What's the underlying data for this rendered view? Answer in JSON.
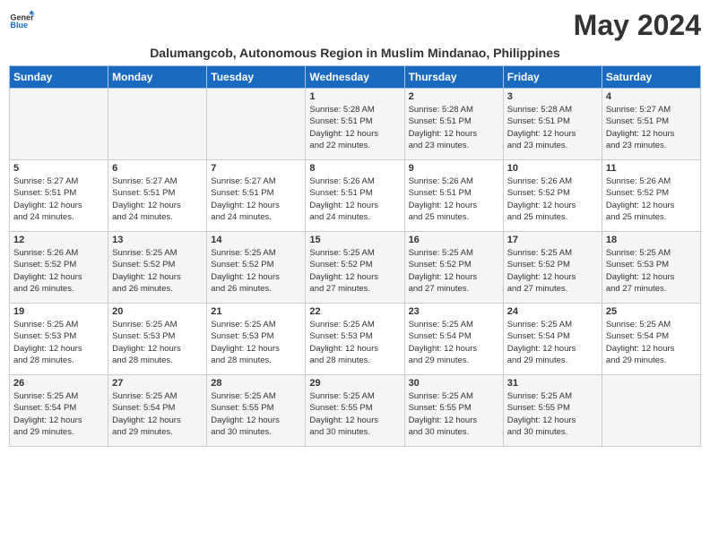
{
  "logo": {
    "line1": "General",
    "line2": "Blue"
  },
  "month_title": "May 2024",
  "location": "Dalumangcob, Autonomous Region in Muslim Mindanao, Philippines",
  "days_of_week": [
    "Sunday",
    "Monday",
    "Tuesday",
    "Wednesday",
    "Thursday",
    "Friday",
    "Saturday"
  ],
  "weeks": [
    [
      {
        "day": "",
        "info": ""
      },
      {
        "day": "",
        "info": ""
      },
      {
        "day": "",
        "info": ""
      },
      {
        "day": "1",
        "info": "Sunrise: 5:28 AM\nSunset: 5:51 PM\nDaylight: 12 hours\nand 22 minutes."
      },
      {
        "day": "2",
        "info": "Sunrise: 5:28 AM\nSunset: 5:51 PM\nDaylight: 12 hours\nand 23 minutes."
      },
      {
        "day": "3",
        "info": "Sunrise: 5:28 AM\nSunset: 5:51 PM\nDaylight: 12 hours\nand 23 minutes."
      },
      {
        "day": "4",
        "info": "Sunrise: 5:27 AM\nSunset: 5:51 PM\nDaylight: 12 hours\nand 23 minutes."
      }
    ],
    [
      {
        "day": "5",
        "info": "Sunrise: 5:27 AM\nSunset: 5:51 PM\nDaylight: 12 hours\nand 24 minutes."
      },
      {
        "day": "6",
        "info": "Sunrise: 5:27 AM\nSunset: 5:51 PM\nDaylight: 12 hours\nand 24 minutes."
      },
      {
        "day": "7",
        "info": "Sunrise: 5:27 AM\nSunset: 5:51 PM\nDaylight: 12 hours\nand 24 minutes."
      },
      {
        "day": "8",
        "info": "Sunrise: 5:26 AM\nSunset: 5:51 PM\nDaylight: 12 hours\nand 24 minutes."
      },
      {
        "day": "9",
        "info": "Sunrise: 5:26 AM\nSunset: 5:51 PM\nDaylight: 12 hours\nand 25 minutes."
      },
      {
        "day": "10",
        "info": "Sunrise: 5:26 AM\nSunset: 5:52 PM\nDaylight: 12 hours\nand 25 minutes."
      },
      {
        "day": "11",
        "info": "Sunrise: 5:26 AM\nSunset: 5:52 PM\nDaylight: 12 hours\nand 25 minutes."
      }
    ],
    [
      {
        "day": "12",
        "info": "Sunrise: 5:26 AM\nSunset: 5:52 PM\nDaylight: 12 hours\nand 26 minutes."
      },
      {
        "day": "13",
        "info": "Sunrise: 5:25 AM\nSunset: 5:52 PM\nDaylight: 12 hours\nand 26 minutes."
      },
      {
        "day": "14",
        "info": "Sunrise: 5:25 AM\nSunset: 5:52 PM\nDaylight: 12 hours\nand 26 minutes."
      },
      {
        "day": "15",
        "info": "Sunrise: 5:25 AM\nSunset: 5:52 PM\nDaylight: 12 hours\nand 27 minutes."
      },
      {
        "day": "16",
        "info": "Sunrise: 5:25 AM\nSunset: 5:52 PM\nDaylight: 12 hours\nand 27 minutes."
      },
      {
        "day": "17",
        "info": "Sunrise: 5:25 AM\nSunset: 5:52 PM\nDaylight: 12 hours\nand 27 minutes."
      },
      {
        "day": "18",
        "info": "Sunrise: 5:25 AM\nSunset: 5:53 PM\nDaylight: 12 hours\nand 27 minutes."
      }
    ],
    [
      {
        "day": "19",
        "info": "Sunrise: 5:25 AM\nSunset: 5:53 PM\nDaylight: 12 hours\nand 28 minutes."
      },
      {
        "day": "20",
        "info": "Sunrise: 5:25 AM\nSunset: 5:53 PM\nDaylight: 12 hours\nand 28 minutes."
      },
      {
        "day": "21",
        "info": "Sunrise: 5:25 AM\nSunset: 5:53 PM\nDaylight: 12 hours\nand 28 minutes."
      },
      {
        "day": "22",
        "info": "Sunrise: 5:25 AM\nSunset: 5:53 PM\nDaylight: 12 hours\nand 28 minutes."
      },
      {
        "day": "23",
        "info": "Sunrise: 5:25 AM\nSunset: 5:54 PM\nDaylight: 12 hours\nand 29 minutes."
      },
      {
        "day": "24",
        "info": "Sunrise: 5:25 AM\nSunset: 5:54 PM\nDaylight: 12 hours\nand 29 minutes."
      },
      {
        "day": "25",
        "info": "Sunrise: 5:25 AM\nSunset: 5:54 PM\nDaylight: 12 hours\nand 29 minutes."
      }
    ],
    [
      {
        "day": "26",
        "info": "Sunrise: 5:25 AM\nSunset: 5:54 PM\nDaylight: 12 hours\nand 29 minutes."
      },
      {
        "day": "27",
        "info": "Sunrise: 5:25 AM\nSunset: 5:54 PM\nDaylight: 12 hours\nand 29 minutes."
      },
      {
        "day": "28",
        "info": "Sunrise: 5:25 AM\nSunset: 5:55 PM\nDaylight: 12 hours\nand 30 minutes."
      },
      {
        "day": "29",
        "info": "Sunrise: 5:25 AM\nSunset: 5:55 PM\nDaylight: 12 hours\nand 30 minutes."
      },
      {
        "day": "30",
        "info": "Sunrise: 5:25 AM\nSunset: 5:55 PM\nDaylight: 12 hours\nand 30 minutes."
      },
      {
        "day": "31",
        "info": "Sunrise: 5:25 AM\nSunset: 5:55 PM\nDaylight: 12 hours\nand 30 minutes."
      },
      {
        "day": "",
        "info": ""
      }
    ]
  ]
}
